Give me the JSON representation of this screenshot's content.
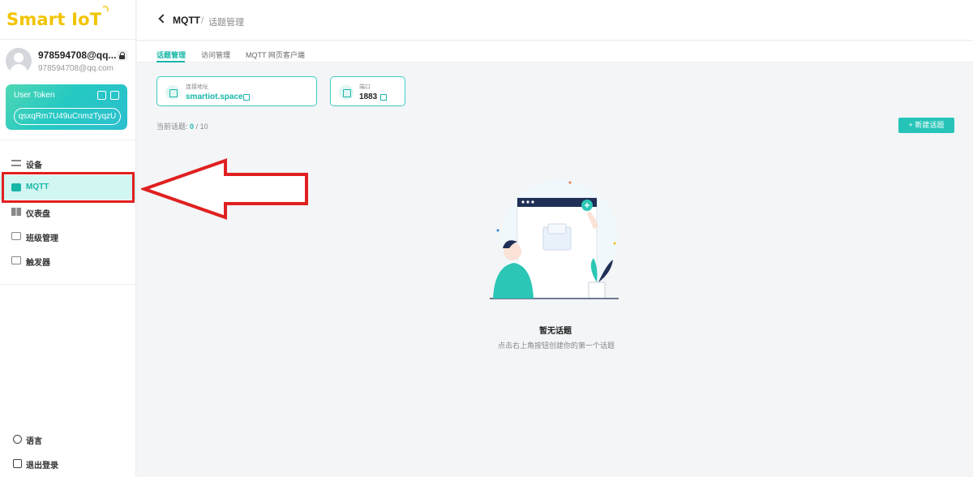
{
  "app": {
    "logo": "Smart IoT"
  },
  "user": {
    "name": "978594708@qq...",
    "email": "978594708@qq.com",
    "token_title": "User Token",
    "token_value": "qsxqRm7U49uCnmzTyqzU"
  },
  "nav": [
    {
      "label": "设备",
      "icon": "device-icon"
    },
    {
      "label": "MQTT",
      "icon": "chat-icon",
      "active": true
    },
    {
      "label": "仪表盘",
      "icon": "dashboard-icon"
    },
    {
      "label": "班级管理",
      "icon": "class-icon"
    },
    {
      "label": "触发器",
      "icon": "trigger-icon"
    }
  ],
  "bottom_nav": [
    {
      "label": "语言",
      "icon": "globe-icon"
    },
    {
      "label": "退出登录",
      "icon": "logout-icon"
    }
  ],
  "header": {
    "crumb_main": "MQTT",
    "separator": "/",
    "crumb_sub": "话题管理"
  },
  "tabs": [
    "话题管理",
    "访问管理",
    "MQTT 网页客户端"
  ],
  "connection": {
    "address_label": "连接地址",
    "address_value": "smartiot.space",
    "port_label": "端口",
    "port_value": "1883"
  },
  "topics": {
    "count_label": "当前话题:",
    "current": "0",
    "max": "/ 10",
    "new_button": "+ 新建话题"
  },
  "empty": {
    "title": "暂无话题",
    "subtitle": "点击右上角按钮创建你的第一个话题"
  },
  "colors": {
    "accent": "#17b6a8",
    "logo": "#f2c400",
    "annotation": "#e02020"
  }
}
